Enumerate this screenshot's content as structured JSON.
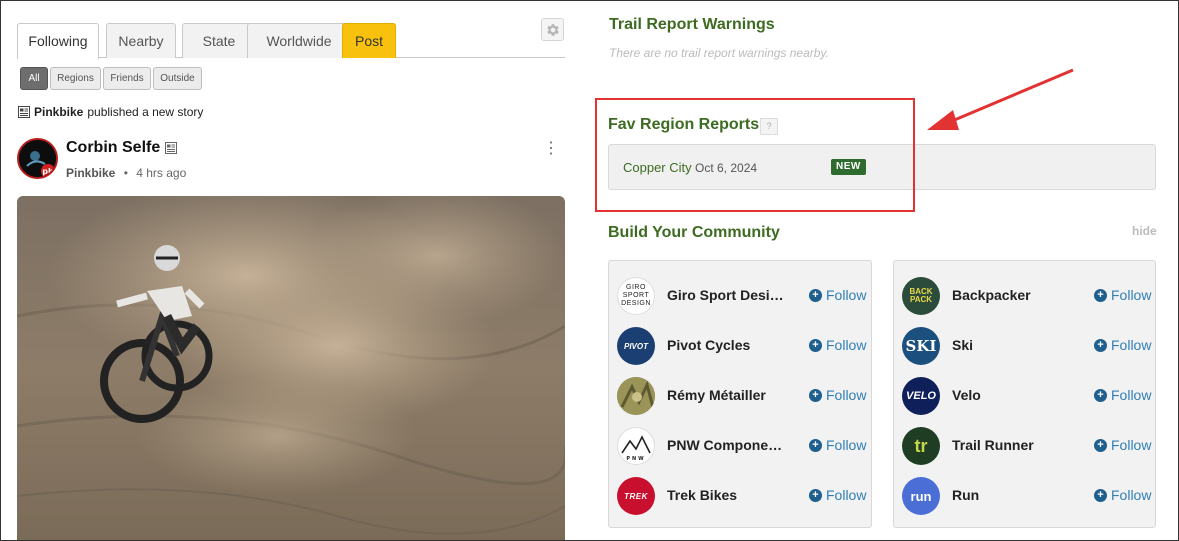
{
  "feed": {
    "tabs": [
      {
        "label": "Following",
        "active": true
      },
      {
        "label": "Nearby"
      },
      {
        "label": "State"
      },
      {
        "label": "Worldwide"
      },
      {
        "label": "Post",
        "accent": "#f7c10e"
      }
    ],
    "filters": [
      {
        "label": "All",
        "active": true
      },
      {
        "label": "Regions"
      },
      {
        "label": "Friends"
      },
      {
        "label": "Outside"
      }
    ],
    "story_note": {
      "publisher": "Pinkbike",
      "text": "published a new story"
    },
    "post": {
      "author": "Corbin Selfe",
      "source": "Pinkbike",
      "separator": "•",
      "time": "4 hrs ago",
      "avatar_badge": "pb"
    }
  },
  "sidebar": {
    "trail_warnings": {
      "title": "Trail Report Warnings",
      "empty_text": "There are no trail report warnings nearby."
    },
    "fav_region_reports": {
      "title": "Fav Region Reports",
      "help_label": "?",
      "reports": [
        {
          "region": "Copper City",
          "date": "Oct 6, 2024",
          "badge": "NEW"
        }
      ]
    },
    "community": {
      "title": "Build Your Community",
      "hide_label": "hide",
      "follow_label": "Follow",
      "left": [
        {
          "name": "Giro Sport Desi…",
          "logo_text": "GIRO SPORT DESIGN"
        },
        {
          "name": "Pivot Cycles",
          "logo_text": "PIVOT"
        },
        {
          "name": "Rémy Métailler",
          "logo_text": ""
        },
        {
          "name": "PNW Compone…",
          "logo_text": "PNW"
        },
        {
          "name": "Trek Bikes",
          "logo_text": "TREK"
        }
      ],
      "right": [
        {
          "name": "Backpacker",
          "logo_text": "BACK PACK"
        },
        {
          "name": "Ski",
          "logo_text": "SKI"
        },
        {
          "name": "Velo",
          "logo_text": "VELO"
        },
        {
          "name": "Trail Runner",
          "logo_text": "tr"
        },
        {
          "name": "Run",
          "logo_text": "run"
        }
      ]
    }
  },
  "colors": {
    "accent_green": "#3d6b22",
    "link_blue": "#2f7fb5",
    "annotation_red": "#e33232",
    "post_yellow": "#f7c10e"
  }
}
